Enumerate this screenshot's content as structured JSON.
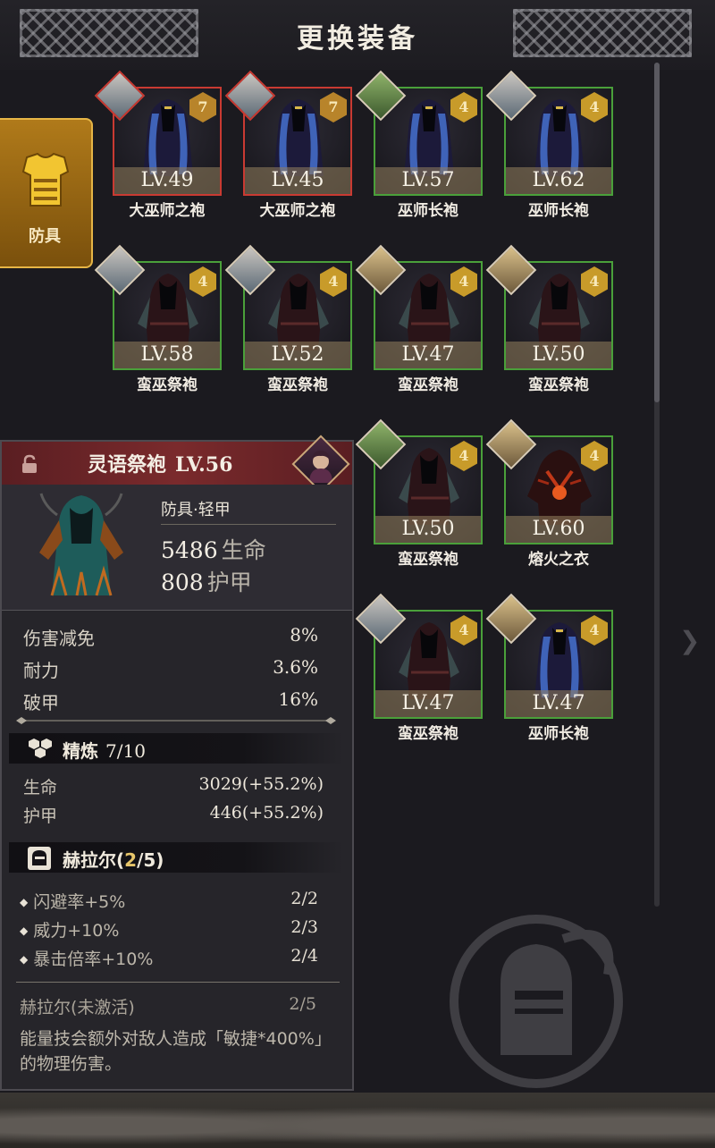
{
  "header": {
    "title": "更换装备"
  },
  "category_tab": {
    "label": "防具"
  },
  "items": [
    {
      "level": "LV.49",
      "name": "大巫师之袍",
      "rarity": "7",
      "border": "red",
      "style": "blue",
      "portrait": "silver"
    },
    {
      "level": "LV.45",
      "name": "大巫师之袍",
      "rarity": "7",
      "border": "red",
      "style": "blue",
      "portrait": "silver"
    },
    {
      "level": "LV.57",
      "name": "巫师长袍",
      "rarity": "4",
      "border": "green",
      "style": "blue",
      "portrait": "green"
    },
    {
      "level": "LV.62",
      "name": "巫师长袍",
      "rarity": "4",
      "border": "green",
      "style": "blue",
      "portrait": "silver"
    },
    {
      "level": "LV.58",
      "name": "蛮巫祭袍",
      "rarity": "4",
      "border": "green",
      "style": "dark",
      "portrait": "silver"
    },
    {
      "level": "LV.52",
      "name": "蛮巫祭袍",
      "rarity": "4",
      "border": "green",
      "style": "dark",
      "portrait": "silver"
    },
    {
      "level": "LV.47",
      "name": "蛮巫祭袍",
      "rarity": "4",
      "border": "green",
      "style": "dark",
      "portrait": "blond"
    },
    {
      "level": "LV.50",
      "name": "蛮巫祭袍",
      "rarity": "4",
      "border": "green",
      "style": "dark",
      "portrait": "blond"
    },
    {
      "level": "LV.50",
      "name": "蛮巫祭袍",
      "rarity": "4",
      "border": "green",
      "style": "dark",
      "portrait": "green"
    },
    {
      "level": "LV.60",
      "name": "熔火之衣",
      "rarity": "4",
      "border": "green",
      "style": "lava",
      "portrait": "blond"
    },
    {
      "level": "LV.47",
      "name": "蛮巫祭袍",
      "rarity": "4",
      "border": "green",
      "style": "dark",
      "portrait": "silver"
    },
    {
      "level": "LV.47",
      "name": "巫师长袍",
      "rarity": "4",
      "border": "green",
      "style": "blue",
      "portrait": "blond"
    }
  ],
  "detail": {
    "name": "灵语祭袍",
    "level": "LV.56",
    "type": "防具·轻甲",
    "main_stats": [
      {
        "value": "5486",
        "label": "生命"
      },
      {
        "value": "808",
        "label": "护甲"
      }
    ],
    "stats": [
      {
        "label": "伤害减免",
        "value": "8%"
      },
      {
        "label": "耐力",
        "value": "3.6%"
      },
      {
        "label": "破甲",
        "value": "16%"
      }
    ],
    "refine": {
      "label": "精炼",
      "count": "7/10",
      "rows": [
        {
          "label": "生命",
          "value": "3029(+55.2%)"
        },
        {
          "label": "护甲",
          "value": "446(+55.2%)"
        }
      ]
    },
    "set": {
      "name": "赫拉尔(",
      "have": "2",
      "total": "/5)",
      "bonuses": [
        {
          "label": "闪避率+5%",
          "value": "2/2"
        },
        {
          "label": "威力+10%",
          "value": "2/3"
        },
        {
          "label": "暴击倍率+10%",
          "value": "2/4"
        }
      ],
      "inactive_label": "赫拉尔(未激活)",
      "inactive_value": "2/5",
      "description": "能量技会额外对敌人造成「敏捷*400%」的物理伤害。"
    }
  },
  "colors": {
    "background": "#1b1a1f",
    "tab_gold": "#b07a1a",
    "border_red": "#c93a32",
    "border_green": "#4aa03a",
    "rarity_gold": "#c89b2a",
    "title_red": "#7a2a2c"
  },
  "icons": {
    "category": "armor-icon",
    "lock": "lock-icon",
    "refine": "refine-icon",
    "set": "set-helmet-icon"
  }
}
